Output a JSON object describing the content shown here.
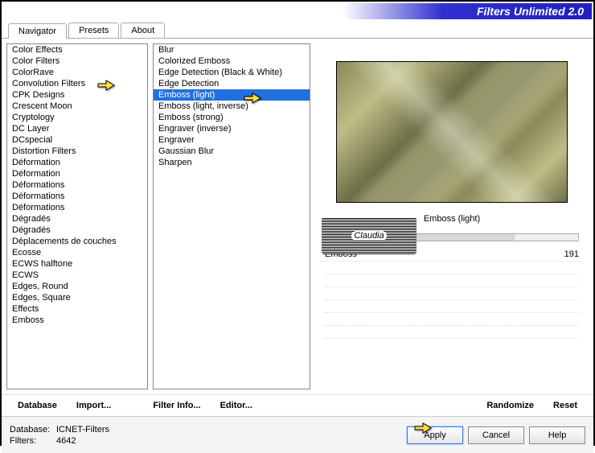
{
  "app_title": "Filters Unlimited 2.0",
  "tabs": [
    "Navigator",
    "Presets",
    "About"
  ],
  "active_tab": "Navigator",
  "categories": [
    "Color Effects",
    "Color Filters",
    "ColorRave",
    "Convolution Filters",
    "CPK Designs",
    "Crescent Moon",
    "Cryptology",
    "DC Layer",
    "DCspecial",
    "Distortion Filters",
    "Déformation",
    "Déformation",
    "Déformations",
    "Déformations",
    "Déformations",
    "Dégradés",
    "Dégradés",
    "Déplacements de couches",
    "Ecosse",
    "ECWS halftone",
    "ECWS",
    "Edges, Round",
    "Edges, Square",
    "Effects",
    "Emboss"
  ],
  "selected_category": "Convolution Filters",
  "filters": [
    "Blur",
    "Colorized Emboss",
    "Edge Detection (Black & White)",
    "Edge Detection",
    "Emboss (light)",
    "Emboss (light, inverse)",
    "Emboss (strong)",
    "Engraver (inverse)",
    "Engraver",
    "Gaussian Blur",
    "Sharpen"
  ],
  "selected_filter": "Emboss (light)",
  "selected_filter_label": "Emboss (light)",
  "params": [
    {
      "name": "Emboss",
      "value": "191"
    }
  ],
  "toolbar": {
    "database": "Database",
    "import": "Import...",
    "filter_info": "Filter Info...",
    "editor": "Editor...",
    "randomize": "Randomize",
    "reset": "Reset"
  },
  "footer": {
    "db_label": "Database:",
    "db_value": "ICNET-Filters",
    "filters_label": "Filters:",
    "filters_value": "4642",
    "apply": "Apply",
    "cancel": "Cancel",
    "help": "Help"
  },
  "watermark": "Claudia"
}
